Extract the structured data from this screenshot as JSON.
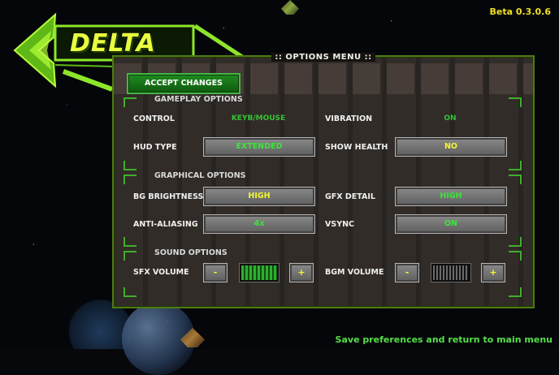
{
  "version": "Beta 0.3.0.6",
  "logo": {
    "text": "DELTA",
    "accent_color": "#a6f01a"
  },
  "panel": {
    "title": ":: OPTIONS MENU ::"
  },
  "accept_button": {
    "label": "ACCEPT CHANGES"
  },
  "sections": {
    "gameplay": "GAMEPLAY OPTIONS",
    "graphical": "GRAPHICAL OPTIONS",
    "sound": "SOUND OPTIONS"
  },
  "gameplay": {
    "control": {
      "label": "CONTROL",
      "value": "KEYB/MOUSE"
    },
    "vibration": {
      "label": "VIBRATION",
      "value": "ON"
    },
    "hud_type": {
      "label": "HUD TYPE",
      "value": "EXTENDED"
    },
    "show_health": {
      "label": "SHOW HEALTH",
      "value": "NO"
    }
  },
  "graphical": {
    "bg_brightness": {
      "label": "BG BRIGHTNESS",
      "value": "HIGH"
    },
    "gfx_detail": {
      "label": "GFX DETAIL",
      "value": "HIGH"
    },
    "anti_aliasing": {
      "label": "ANTI-ALIASING",
      "value": "4x"
    },
    "vsync": {
      "label": "VSYNC",
      "value": "ON"
    }
  },
  "sound": {
    "sfx_volume": {
      "label": "SFX VOLUME",
      "minus": "-",
      "plus": "+",
      "level": 1.0
    },
    "bgm_volume": {
      "label": "BGM VOLUME",
      "minus": "-",
      "plus": "+",
      "level": 0.0
    }
  },
  "footer": "Save preferences and return to main menu",
  "colors": {
    "value_green": "#3be53b",
    "value_yellow": "#f5f530",
    "footer": "#56e048",
    "version": "#f2e020"
  }
}
